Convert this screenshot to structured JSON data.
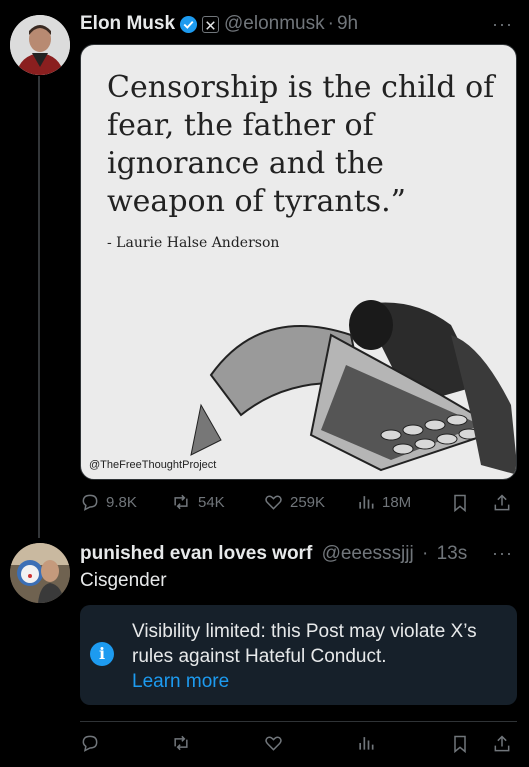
{
  "post1": {
    "author_name": "Elon Musk",
    "handle": "@elonmusk",
    "separator": "·",
    "time": "9h",
    "more_label": "···",
    "media": {
      "quote": "Censorship is the child of fear, the father of ignorance and the weapon of tyrants.”",
      "author": "- Laurie Halse Anderson",
      "credit": "@TheFreeThoughtProject"
    },
    "stats": {
      "replies": "9.8K",
      "reposts": "54K",
      "likes": "259K",
      "views": "18M"
    }
  },
  "post2": {
    "author_name": "punished evan loves worf",
    "handle": "@eeesssjjj",
    "separator": "·",
    "time": "13s",
    "more_label": "···",
    "text": "Cisgender",
    "notice": {
      "icon": "i",
      "text": "Visibility limited: this Post may violate X’s rules against Hateful Conduct.",
      "link": "Learn more"
    }
  },
  "colors": {
    "background": "#000000",
    "text": "#e7e9ea",
    "secondary": "#71767b",
    "accent": "#1d9bf0",
    "notice_bg": "#16202a"
  }
}
